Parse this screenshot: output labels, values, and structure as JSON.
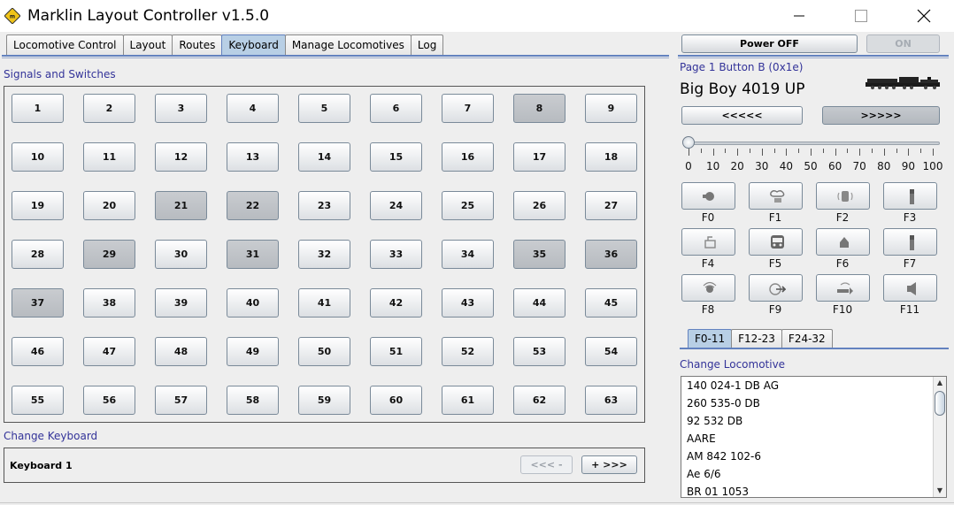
{
  "window": {
    "title": "Marklin Layout Controller v1.5.0",
    "icon": "marklin-logo-icon"
  },
  "tabs": [
    {
      "label": "Locomotive Control",
      "active": false
    },
    {
      "label": "Layout",
      "active": false
    },
    {
      "label": "Routes",
      "active": false
    },
    {
      "label": "Keyboard",
      "active": true
    },
    {
      "label": "Manage Locomotives",
      "active": false
    },
    {
      "label": "Log",
      "active": false
    }
  ],
  "signals": {
    "section_label": "Signals and Switches",
    "keys": [
      {
        "label": "1",
        "on": false
      },
      {
        "label": "2",
        "on": false
      },
      {
        "label": "3",
        "on": false
      },
      {
        "label": "4",
        "on": false
      },
      {
        "label": "5",
        "on": false
      },
      {
        "label": "6",
        "on": false
      },
      {
        "label": "7",
        "on": false
      },
      {
        "label": "8",
        "on": true
      },
      {
        "label": "9",
        "on": false
      },
      {
        "label": "10",
        "on": false
      },
      {
        "label": "11",
        "on": false
      },
      {
        "label": "12",
        "on": false
      },
      {
        "label": "13",
        "on": false
      },
      {
        "label": "14",
        "on": false
      },
      {
        "label": "15",
        "on": false
      },
      {
        "label": "16",
        "on": false
      },
      {
        "label": "17",
        "on": false
      },
      {
        "label": "18",
        "on": false
      },
      {
        "label": "19",
        "on": false
      },
      {
        "label": "20",
        "on": false
      },
      {
        "label": "21",
        "on": true
      },
      {
        "label": "22",
        "on": true
      },
      {
        "label": "23",
        "on": false
      },
      {
        "label": "24",
        "on": false
      },
      {
        "label": "25",
        "on": false
      },
      {
        "label": "26",
        "on": false
      },
      {
        "label": "27",
        "on": false
      },
      {
        "label": "28",
        "on": false
      },
      {
        "label": "29",
        "on": true
      },
      {
        "label": "30",
        "on": false
      },
      {
        "label": "31",
        "on": true
      },
      {
        "label": "32",
        "on": false
      },
      {
        "label": "33",
        "on": false
      },
      {
        "label": "34",
        "on": false
      },
      {
        "label": "35",
        "on": true
      },
      {
        "label": "36",
        "on": true
      },
      {
        "label": "37",
        "on": true
      },
      {
        "label": "38",
        "on": false
      },
      {
        "label": "39",
        "on": false
      },
      {
        "label": "40",
        "on": false
      },
      {
        "label": "41",
        "on": false
      },
      {
        "label": "42",
        "on": false
      },
      {
        "label": "43",
        "on": false
      },
      {
        "label": "44",
        "on": false
      },
      {
        "label": "45",
        "on": false
      },
      {
        "label": "46",
        "on": false
      },
      {
        "label": "47",
        "on": false
      },
      {
        "label": "48",
        "on": false
      },
      {
        "label": "49",
        "on": false
      },
      {
        "label": "50",
        "on": false
      },
      {
        "label": "51",
        "on": false
      },
      {
        "label": "52",
        "on": false
      },
      {
        "label": "53",
        "on": false
      },
      {
        "label": "54",
        "on": false
      },
      {
        "label": "55",
        "on": false
      },
      {
        "label": "56",
        "on": false
      },
      {
        "label": "57",
        "on": false
      },
      {
        "label": "58",
        "on": false
      },
      {
        "label": "59",
        "on": false
      },
      {
        "label": "60",
        "on": false
      },
      {
        "label": "61",
        "on": false
      },
      {
        "label": "62",
        "on": false
      },
      {
        "label": "63",
        "on": false
      }
    ]
  },
  "keyboard": {
    "section_label": "Change Keyboard",
    "name": "Keyboard 1",
    "prev_label": "<<< -",
    "next_label": "+ >>>"
  },
  "power": {
    "off_label": "Power OFF",
    "on_label": "ON"
  },
  "locomotive": {
    "page_info": "Page 1 Button B  (0x1e)",
    "name": "Big Boy 4019 UP",
    "reverse_label": "<<<<<",
    "forward_label": ">>>>>",
    "speed": 0,
    "speed_ticks": [
      "0",
      "10",
      "20",
      "30",
      "40",
      "50",
      "60",
      "70",
      "80",
      "90",
      "100"
    ]
  },
  "functions": {
    "buttons": [
      {
        "label": "F0",
        "icon": "headlight-icon"
      },
      {
        "label": "F1",
        "icon": "smoke-icon"
      },
      {
        "label": "F2",
        "icon": "sound-loco-icon"
      },
      {
        "label": "F3",
        "icon": "marker-icon"
      },
      {
        "label": "F4",
        "icon": "coupler-icon"
      },
      {
        "label": "F5",
        "icon": "cab-icon"
      },
      {
        "label": "F6",
        "icon": "bell-icon"
      },
      {
        "label": "F7",
        "icon": "marker-icon"
      },
      {
        "label": "F8",
        "icon": "sound-icon"
      },
      {
        "label": "F9",
        "icon": "shunting-icon"
      },
      {
        "label": "F10",
        "icon": "horn-icon"
      },
      {
        "label": "F11",
        "icon": "speaker-icon"
      }
    ],
    "tabs": [
      {
        "label": "F0-11",
        "active": true
      },
      {
        "label": "F12-23",
        "active": false
      },
      {
        "label": "F24-32",
        "active": false
      }
    ]
  },
  "change_locomotive": {
    "section_label": "Change Locomotive",
    "items": [
      "140 024-1 DB AG",
      "260 535-0 DB",
      "92 532 DB",
      "AARE",
      "AM 842 102-6",
      "Ae 6/6",
      "BR 01 1053"
    ]
  }
}
